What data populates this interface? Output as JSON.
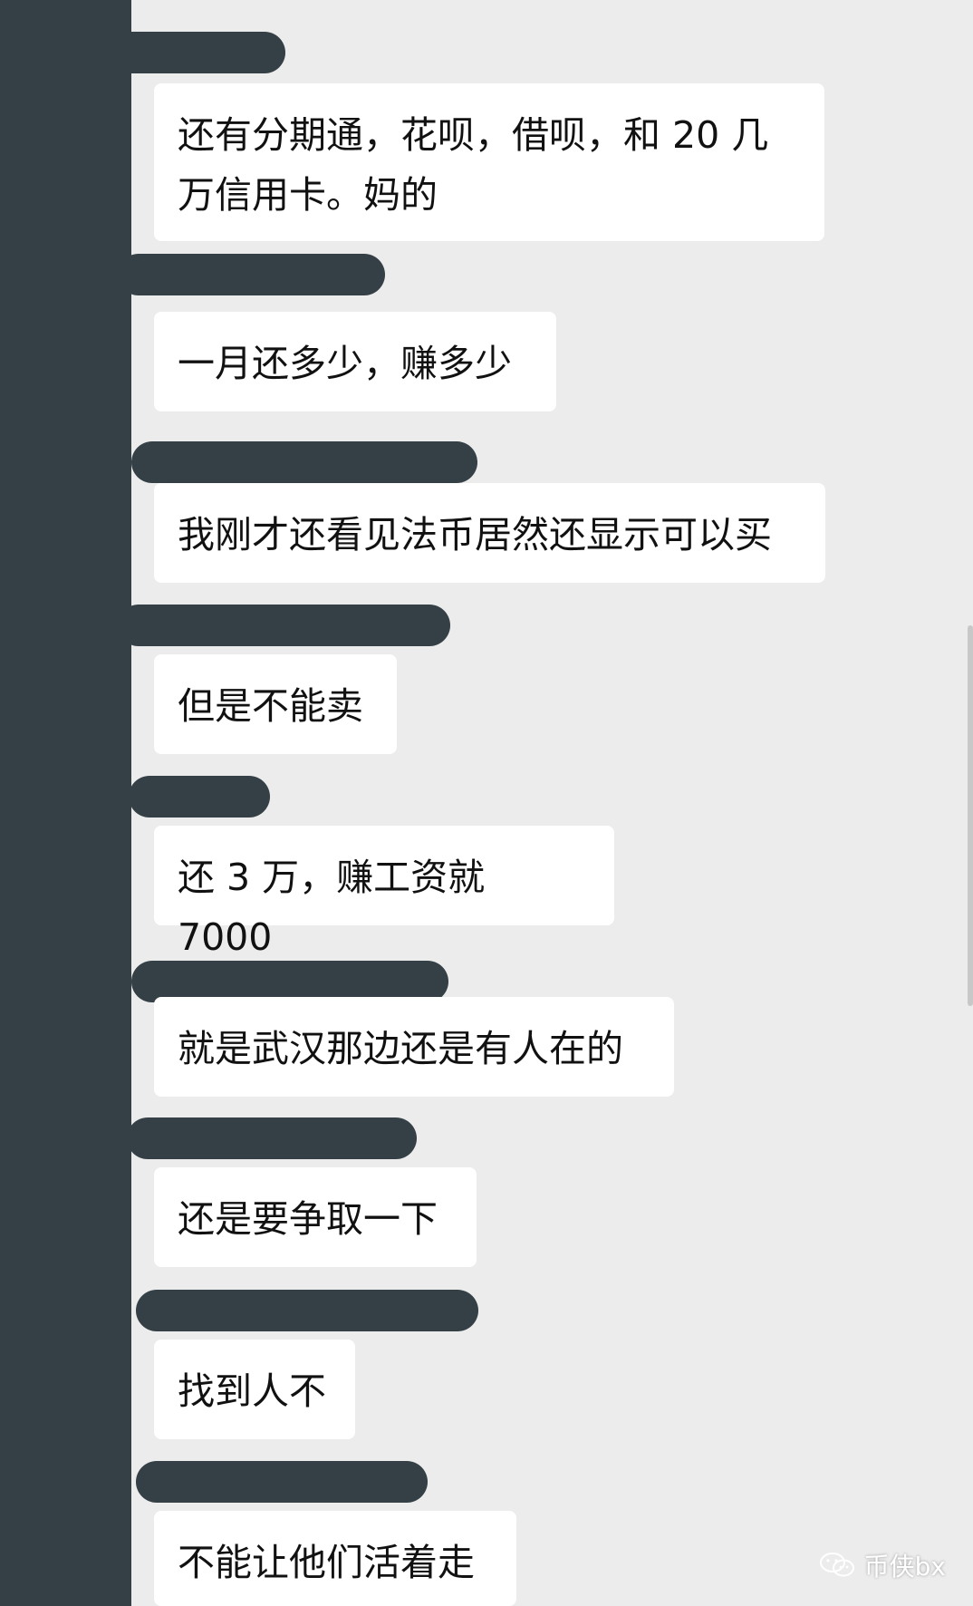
{
  "messages": [
    {
      "text": "还有分期通，花呗，借呗，和 20 几\n万信用卡。妈的"
    },
    {
      "text": "一月还多少，赚多少"
    },
    {
      "text": "我刚才还看见法币居然还显示可以买"
    },
    {
      "text": "但是不能卖"
    },
    {
      "text": "还 3 万，赚工资就 7000"
    },
    {
      "text": "就是武汉那边还是有人在的"
    },
    {
      "text": "还是要争取一下"
    },
    {
      "text": "找到人不"
    },
    {
      "text": "不能让他们活着走"
    }
  ],
  "watermark": {
    "text": "币侠bx",
    "icon": "wechat-official-account-icon"
  },
  "colors": {
    "background": "#ececec",
    "bubble": "#ffffff",
    "redaction": "#354046"
  }
}
